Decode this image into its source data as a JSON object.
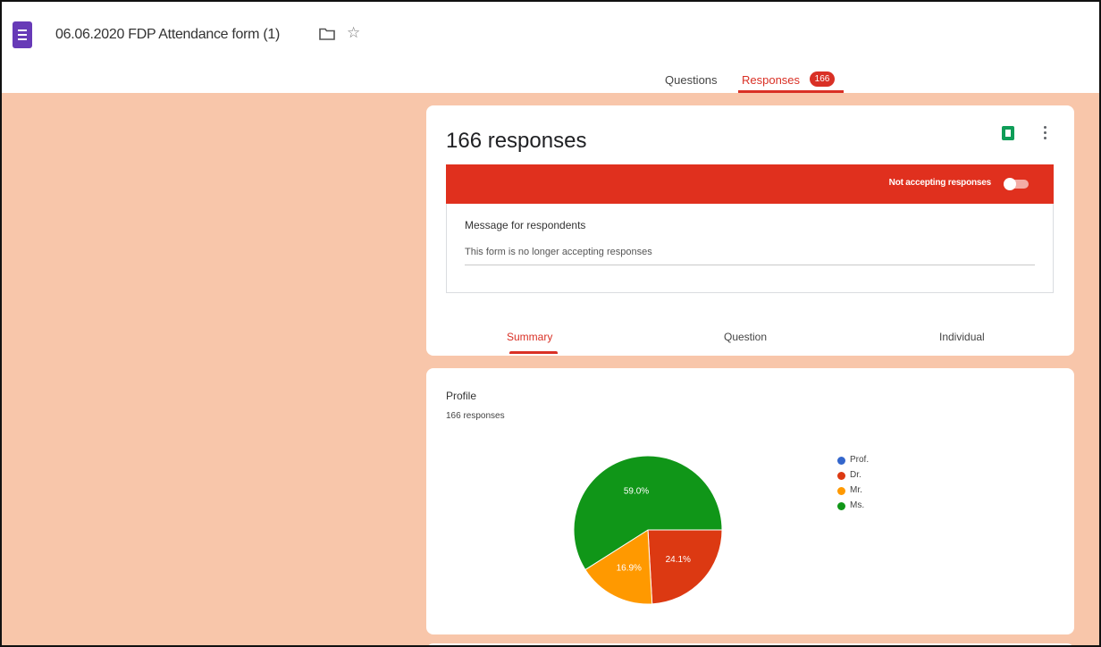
{
  "header": {
    "doc_title": "06.06.2020 FDP Attendance form (1)",
    "tabs": [
      {
        "label": "Questions"
      },
      {
        "label": "Responses",
        "badge": "166"
      }
    ],
    "active_tab": "Responses"
  },
  "responses_card": {
    "count_label": "166 responses",
    "accepting_label": "Not accepting responses",
    "accepting": false,
    "message_label": "Message for respondents",
    "message_value": "This form is no longer accepting responses",
    "tabs": [
      "Summary",
      "Question",
      "Individual"
    ],
    "active_tab": "Summary"
  },
  "question_card": {
    "title": "Profile",
    "responses_label": "166 responses"
  },
  "chart_data": {
    "type": "pie",
    "categories": [
      "Prof.",
      "Dr.",
      "Mr.",
      "Ms."
    ],
    "values": [
      0,
      24.1,
      16.9,
      59.0
    ],
    "data_labels": [
      "",
      "24.1%",
      "16.9%",
      "59.0%"
    ],
    "colors": [
      "#3366cc",
      "#dc3912",
      "#ff9900",
      "#109618"
    ],
    "legend_position": "right"
  },
  "colors": {
    "accent": "#d93025",
    "forms_purple": "#673ab7",
    "page_background": "#f8c6aa"
  }
}
